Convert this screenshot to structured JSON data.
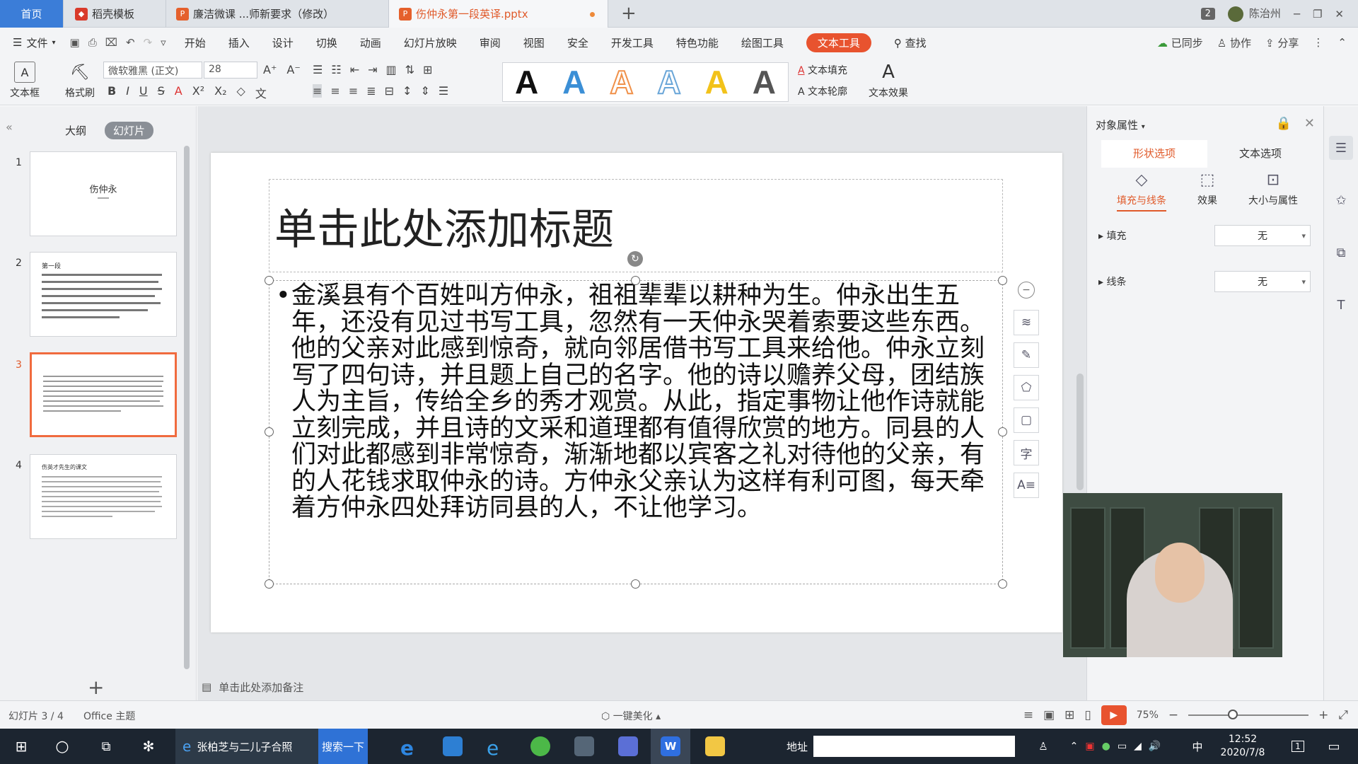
{
  "tabs": {
    "home": "首页",
    "tab1": "稻壳模板",
    "tab2": "廉洁微课 ...师新要求（修改）",
    "tab3": "伤仲永第一段英译.pptx",
    "window_count": "2",
    "user": "陈治州"
  },
  "menu": {
    "file": "文件",
    "items": [
      "开始",
      "插入",
      "设计",
      "切换",
      "动画",
      "幻灯片放映",
      "审阅",
      "视图",
      "安全",
      "开发工具",
      "特色功能",
      "绘图工具",
      "文本工具"
    ],
    "find": "查找",
    "synced": "已同步",
    "collab": "协作",
    "share": "分享"
  },
  "ribbon": {
    "textbox": "文本框",
    "format_painter": "格式刷",
    "font": "微软雅黑 (正文)",
    "size": "28",
    "text_fill": "文本填充",
    "text_outline": "文本轮廓",
    "text_effect": "文本效果",
    "styles": [
      {
        "letter": "A",
        "color": "#111111",
        "outline": false
      },
      {
        "letter": "A",
        "color": "#3b8fd6",
        "outline": false
      },
      {
        "letter": "A",
        "color": "#f0914a",
        "outline": true
      },
      {
        "letter": "A",
        "color": "#6aa6d8",
        "outline": true
      },
      {
        "letter": "A",
        "color": "#f2c21a",
        "outline": false
      },
      {
        "letter": "A",
        "color": "#555555",
        "outline": false
      }
    ]
  },
  "left": {
    "outline_tab": "大纲",
    "slides_tab": "幻灯片",
    "thumbs": [
      {
        "num": "1",
        "title": "伤仲永"
      },
      {
        "num": "2",
        "title": "第一段"
      },
      {
        "num": "3",
        "title": ""
      },
      {
        "num": "4",
        "title": "伤英才先生的课文"
      }
    ]
  },
  "slide": {
    "title": "单击此处添加标题",
    "body": "金溪县有个百姓叫方仲永，祖祖辈辈以耕种为生。仲永出生五年，还没有见过书写工具，忽然有一天仲永哭着索要这些东西。他的父亲对此感到惊奇，就向邻居借书写工具来给他。仲永立刻写了四句诗，并且题上自己的名字。他的诗以赡养父母，团结族人为主旨，传给全乡的秀才观赏。从此，指定事物让他作诗就能立刻完成，并且诗的文采和道理都有值得欣赏的地方。同县的人们对此都感到非常惊奇，渐渐地都以宾客之礼对待他的父亲，有的人花钱求取仲永的诗。方仲永父亲认为这样有利可图，每天牵着方仲永四处拜访同县的人，不让他学习。",
    "notes": "单击此处添加备注"
  },
  "props": {
    "title": "对象属性",
    "tab_shape": "形状选项",
    "tab_text": "文本选项",
    "sub_fill": "填充与线条",
    "sub_effect": "效果",
    "sub_size": "大小与属性",
    "fill_label": "填充",
    "fill_value": "无",
    "line_label": "线条",
    "line_value": "无"
  },
  "status": {
    "slide": "幻灯片 3 / 4",
    "theme": "Office 主题",
    "beautify": "一键美化",
    "zoom": "75%"
  },
  "taskbar": {
    "search_text": "张柏芝与二儿子合照",
    "search_btn": "搜索一下",
    "address": "地址",
    "time": "12:52",
    "date": "2020/7/8",
    "ime": "中",
    "notif": "1"
  }
}
